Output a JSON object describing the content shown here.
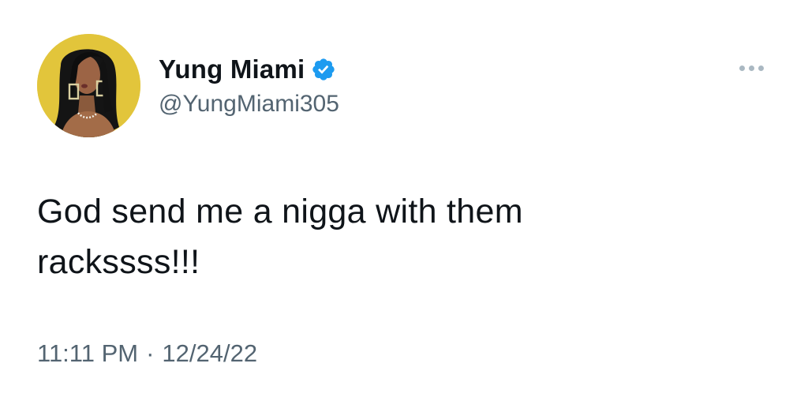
{
  "author": {
    "display_name": "Yung Miami",
    "handle": "@YungMiami305",
    "verified": true,
    "avatar_icon": "profile-photo"
  },
  "tweet": {
    "text": "God send me a nigga with them\nrackssss!!!",
    "time": "11:11 PM",
    "separator": "·",
    "date": "12/24/22"
  },
  "icons": {
    "verified": "verified-badge-icon",
    "more": "more-options-icon"
  },
  "colors": {
    "text": "#0f1419",
    "secondary": "#536471",
    "verified_blue": "#1d9bf0",
    "avatar_background": "#e3c73d",
    "more_dots": "#aab8c2"
  }
}
